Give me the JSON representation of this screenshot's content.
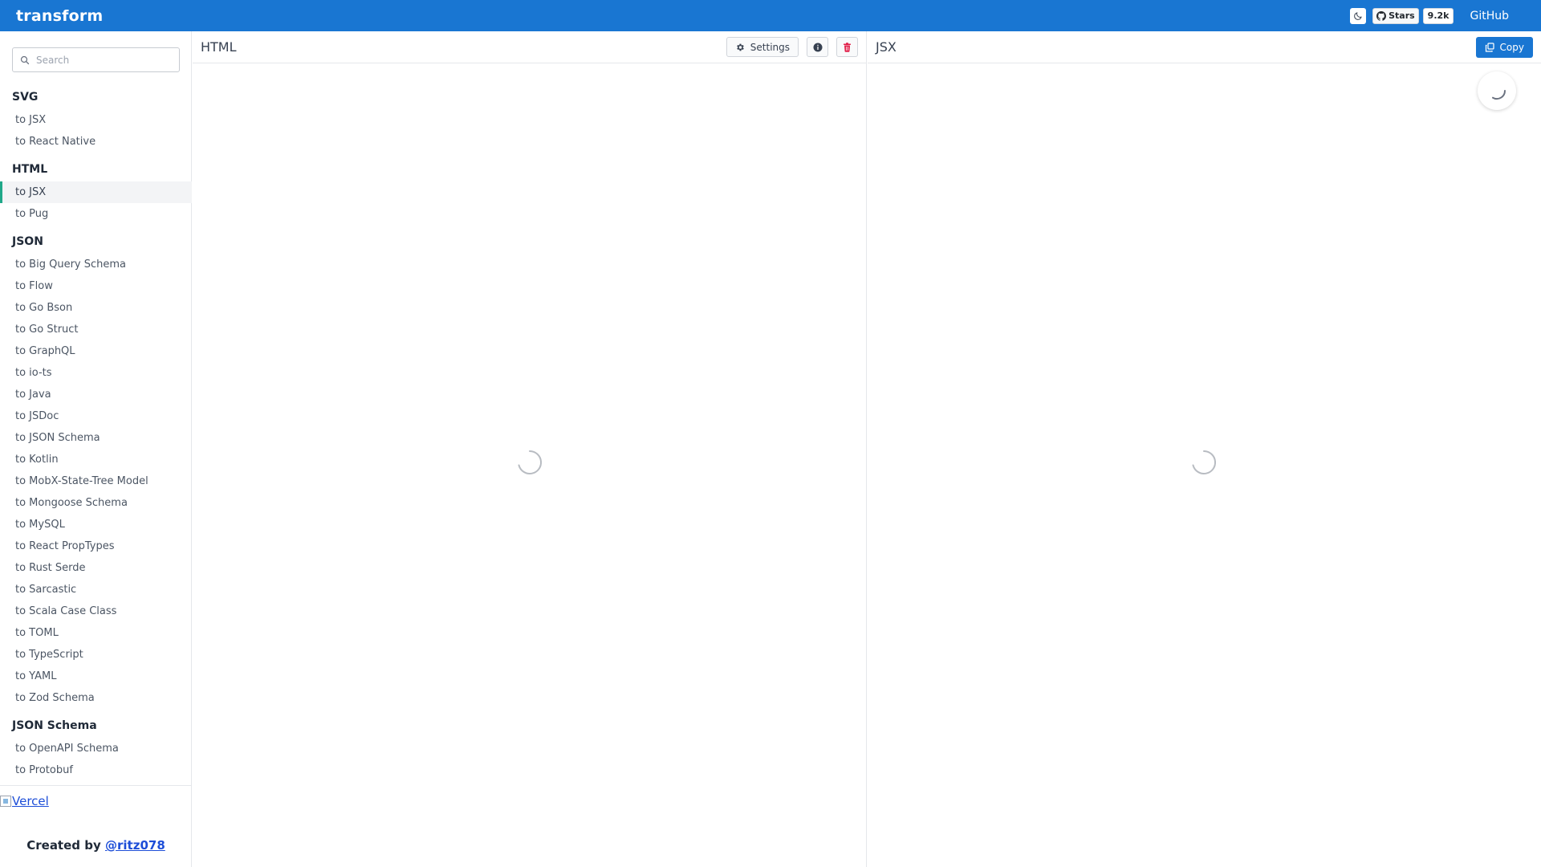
{
  "app": {
    "title": "transform"
  },
  "topbar": {
    "github_stars_label": "Stars",
    "github_stars_count": "9.2k",
    "github_link": "GitHub"
  },
  "search": {
    "placeholder": "Search"
  },
  "sidebar": {
    "sections": [
      {
        "title": "SVG",
        "items": [
          "to JSX",
          "to React Native"
        ]
      },
      {
        "title": "HTML",
        "items": [
          "to JSX",
          "to Pug"
        ]
      },
      {
        "title": "JSON",
        "items": [
          "to Big Query Schema",
          "to Flow",
          "to Go Bson",
          "to Go Struct",
          "to GraphQL",
          "to io-ts",
          "to Java",
          "to JSDoc",
          "to JSON Schema",
          "to Kotlin",
          "to MobX-State-Tree Model",
          "to Mongoose Schema",
          "to MySQL",
          "to React PropTypes",
          "to Rust Serde",
          "to Sarcastic",
          "to Scala Case Class",
          "to TOML",
          "to TypeScript",
          "to YAML",
          "to Zod Schema"
        ]
      },
      {
        "title": "JSON Schema",
        "items": [
          "to OpenAPI Schema",
          "to Protobuf"
        ]
      }
    ],
    "active": {
      "section": "HTML",
      "item": "to JSX"
    },
    "sponsor_alt": "Vercel",
    "created_by": "Created by",
    "author": "@ritz078"
  },
  "panels": {
    "input": {
      "title": "HTML",
      "settings_label": "Settings"
    },
    "output": {
      "title": "JSX",
      "copy_label": "Copy"
    }
  },
  "icons": {
    "theme": "moon-icon",
    "github": "github-icon",
    "search": "search-icon",
    "settings": "gear-icon",
    "info": "info-icon",
    "delete": "trash-icon",
    "copy": "copy-icon"
  },
  "colors": {
    "brand": "#1976d2",
    "active_indicator": "#20a889",
    "delete": "#e11d48"
  }
}
